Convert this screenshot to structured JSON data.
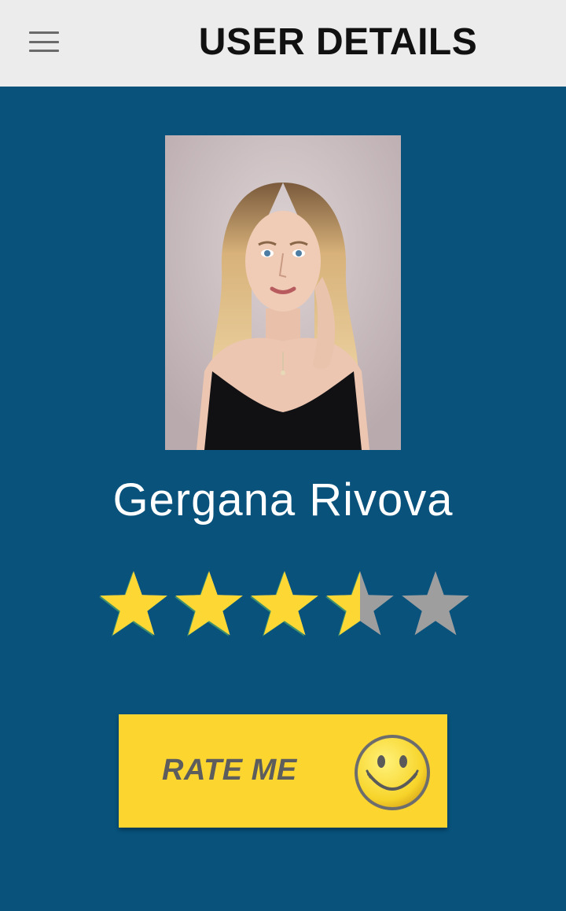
{
  "header": {
    "title": "USER DETAILS",
    "menu_icon": "hamburger-menu-icon"
  },
  "profile": {
    "name": "Gergana Rivova",
    "photo": "user-portrait-photo"
  },
  "rating": {
    "value": 3.5,
    "max": 5,
    "filled_color": "#fdd835",
    "empty_color": "#9e9e9e"
  },
  "rate_button": {
    "label": "RATE ME",
    "icon": "smiley-face-icon"
  },
  "colors": {
    "background": "#08527c",
    "appbar": "#ececec",
    "button": "#fdd52f"
  }
}
